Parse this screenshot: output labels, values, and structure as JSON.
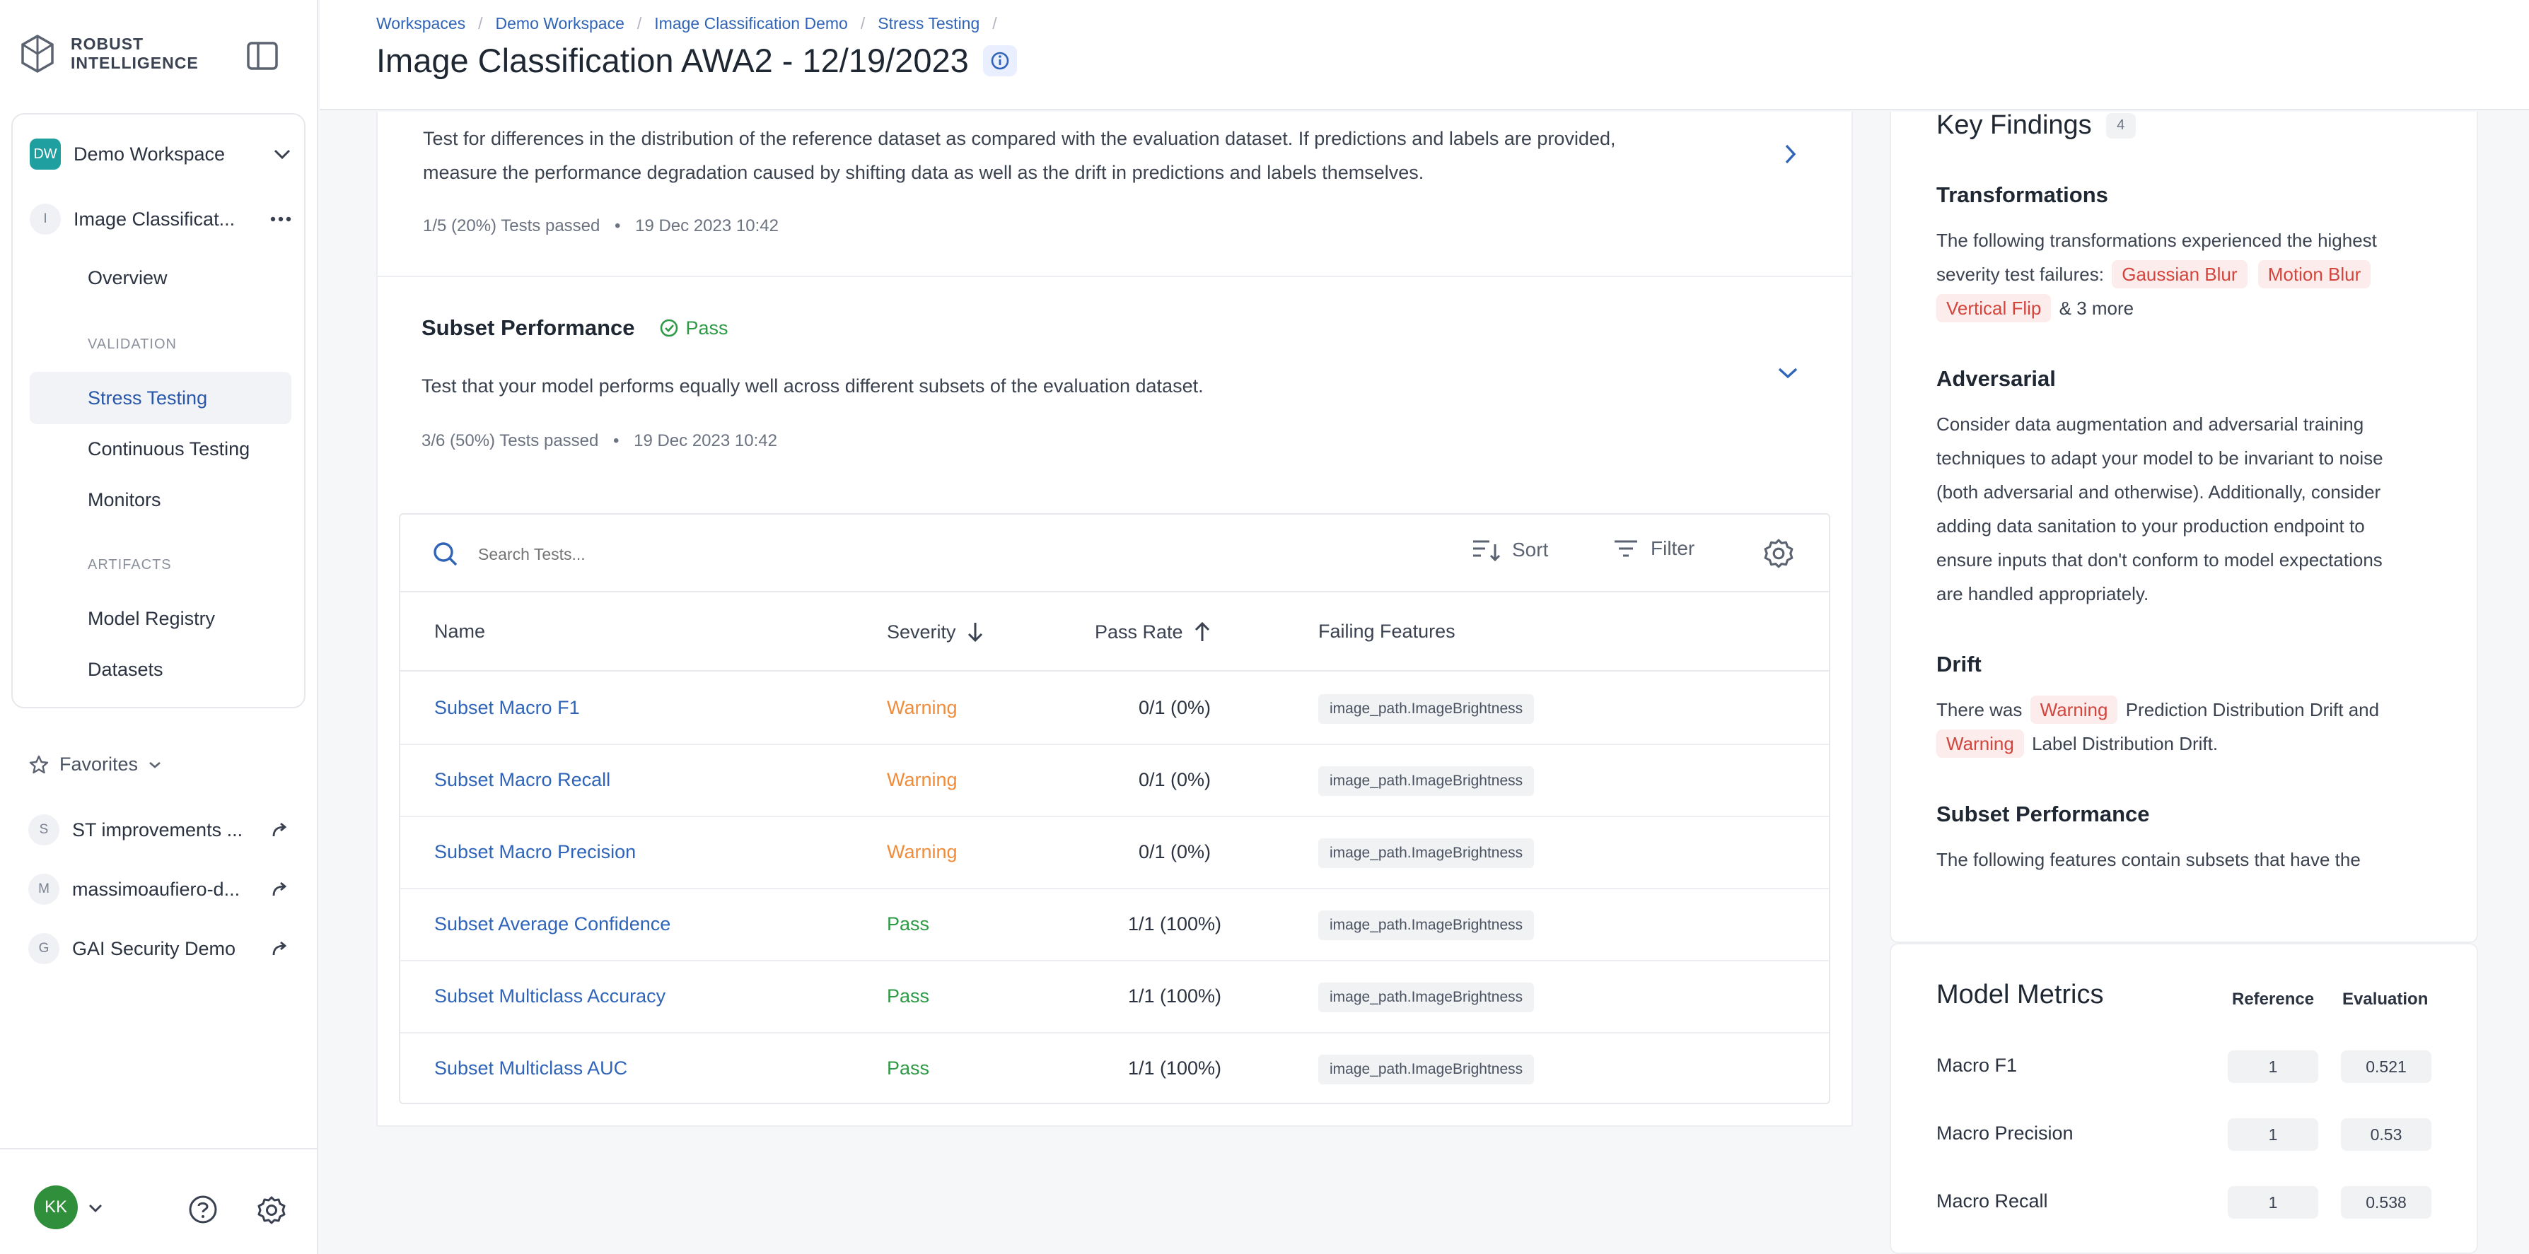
{
  "brand": {
    "line1": "ROBUST",
    "line2": "INTELLIGENCE"
  },
  "sidebar": {
    "workspace": {
      "initials": "DW",
      "name": "Demo Workspace"
    },
    "project": {
      "letter": "I",
      "name": "Image Classificat..."
    },
    "nav": {
      "overview": "Overview",
      "validation_section": "VALIDATION",
      "stress_testing": "Stress Testing",
      "continuous_testing": "Continuous Testing",
      "monitors": "Monitors",
      "artifacts_section": "ARTIFACTS",
      "model_registry": "Model Registry",
      "datasets": "Datasets"
    },
    "favorites": {
      "label": "Favorites",
      "items": [
        {
          "letter": "S",
          "name": "ST improvements ..."
        },
        {
          "letter": "M",
          "name": "massimoaufiero-d..."
        },
        {
          "letter": "G",
          "name": "GAI Security Demo"
        }
      ]
    },
    "user_initials": "KK"
  },
  "header": {
    "breadcrumb": [
      "Workspaces",
      "Demo Workspace",
      "Image Classification Demo",
      "Stress Testing"
    ],
    "title": "Image Classification AWA2 - 12/19/2023"
  },
  "drift": {
    "description_line1": "Test for differences in the distribution of the reference dataset as compared with the evaluation dataset. If predictions and labels are provided,",
    "description_line2": "measure the performance degradation caused by shifting data as well as the drift in predictions and labels themselves.",
    "tests_passed": "1/5 (20%) Tests passed",
    "timestamp": "19 Dec 2023 10:42"
  },
  "subset": {
    "title": "Subset Performance",
    "status": "Pass",
    "description": "Test that your model performs equally well across different subsets of the evaluation dataset.",
    "tests_passed": "3/6 (50%) Tests passed",
    "timestamp": "19 Dec 2023 10:42"
  },
  "table": {
    "search_placeholder": "Search Tests...",
    "sort_label": "Sort",
    "filter_label": "Filter",
    "columns": {
      "name": "Name",
      "severity": "Severity",
      "pass_rate": "Pass Rate",
      "failing_features": "Failing Features"
    },
    "rows": [
      {
        "name": "Subset Macro F1",
        "severity": "Warning",
        "pass_rate": "0/1 (0%)",
        "feature": "image_path.ImageBrightness"
      },
      {
        "name": "Subset Macro Recall",
        "severity": "Warning",
        "pass_rate": "0/1 (0%)",
        "feature": "image_path.ImageBrightness"
      },
      {
        "name": "Subset Macro Precision",
        "severity": "Warning",
        "pass_rate": "0/1 (0%)",
        "feature": "image_path.ImageBrightness"
      },
      {
        "name": "Subset Average Confidence",
        "severity": "Pass",
        "pass_rate": "1/1 (100%)",
        "feature": "image_path.ImageBrightness"
      },
      {
        "name": "Subset Multiclass Accuracy",
        "severity": "Pass",
        "pass_rate": "1/1 (100%)",
        "feature": "image_path.ImageBrightness"
      },
      {
        "name": "Subset Multiclass AUC",
        "severity": "Pass",
        "pass_rate": "1/1 (100%)",
        "feature": "image_path.ImageBrightness"
      }
    ]
  },
  "key_findings": {
    "title": "Key Findings",
    "count": "4",
    "transformations": {
      "heading": "Transformations",
      "text_line1": "The following transformations experienced the highest",
      "text_prefix": "severity test failures:",
      "tags": [
        "Gaussian Blur",
        "Motion Blur",
        "Vertical Flip"
      ],
      "more": "& 3 more"
    },
    "adversarial": {
      "heading": "Adversarial",
      "lines": [
        "Consider data augmentation and adversarial training",
        "techniques to adapt your model to be invariant to noise",
        "(both adversarial and otherwise). Additionally, consider",
        "adding data sanitation to your production endpoint to",
        "ensure inputs that don't conform to model expectations",
        "are handled appropriately."
      ]
    },
    "drift": {
      "heading": "Drift",
      "prefix": "There was",
      "tag1": "Warning",
      "mid": "Prediction Distribution Drift and",
      "tag2": "Warning",
      "suffix": "Label Distribution Drift."
    },
    "subset": {
      "heading": "Subset Performance",
      "text": "The following features contain subsets that have the"
    }
  },
  "model_metrics": {
    "title": "Model Metrics",
    "col_reference": "Reference",
    "col_evaluation": "Evaluation",
    "rows": [
      {
        "label": "Macro F1",
        "reference": "1",
        "evaluation": "0.521"
      },
      {
        "label": "Macro Precision",
        "reference": "1",
        "evaluation": "0.53"
      },
      {
        "label": "Macro Recall",
        "reference": "1",
        "evaluation": "0.538"
      }
    ]
  },
  "colors": {
    "link": "#2f64b8",
    "warning": "#f08c3a",
    "pass": "#2e9a45",
    "tag_red_bg": "#fdecec",
    "tag_red_text": "#d2453d"
  }
}
